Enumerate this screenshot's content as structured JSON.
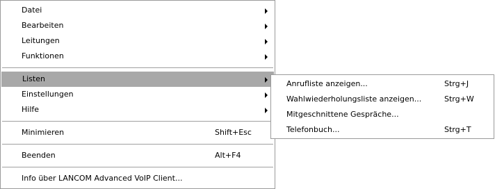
{
  "main_menu": {
    "items": [
      {
        "label": "Datei",
        "submenu": true
      },
      {
        "label": "Bearbeiten",
        "submenu": true
      },
      {
        "label": "Leitungen",
        "submenu": true
      },
      {
        "label": "Funktionen",
        "submenu": true
      },
      {
        "label": "Listen",
        "submenu": true,
        "highlighted": true
      },
      {
        "label": "Einstellungen",
        "submenu": true
      },
      {
        "label": "Hilfe",
        "submenu": true
      },
      {
        "label": "Minimieren",
        "shortcut": "Shift+Esc"
      },
      {
        "label": "Beenden",
        "shortcut": "Alt+F4"
      },
      {
        "label": "Info über LANCOM Advanced VoIP Client..."
      }
    ]
  },
  "listen_submenu": {
    "items": [
      {
        "label": "Anrufliste anzeigen...",
        "shortcut": "Strg+J"
      },
      {
        "label": "Wahlwiederholungsliste anzeigen...",
        "shortcut": "Strg+W"
      },
      {
        "label": "Mitgeschnittene Gespräche..."
      },
      {
        "label": "Telefonbuch...",
        "shortcut": "Strg+T"
      }
    ]
  },
  "colors": {
    "highlight": "#a8a8a8",
    "border": "#9a9a9a",
    "separator": "#a0a0a0"
  }
}
